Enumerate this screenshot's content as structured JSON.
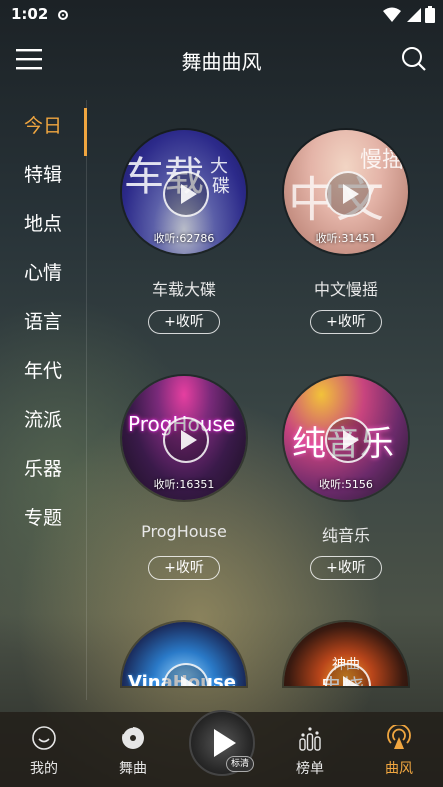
{
  "status": {
    "time": "1:02"
  },
  "header": {
    "title": "舞曲曲风"
  },
  "sidebar": {
    "items": [
      {
        "label": "今日"
      },
      {
        "label": "特辑"
      },
      {
        "label": "地点"
      },
      {
        "label": "心情"
      },
      {
        "label": "语言"
      },
      {
        "label": "年代"
      },
      {
        "label": "流派"
      },
      {
        "label": "乐器"
      },
      {
        "label": "专题"
      }
    ],
    "active_index": 0
  },
  "cards": [
    {
      "name": "车载大碟",
      "listens": "收听:62786",
      "add_label": "+收听",
      "cover_text": "车载",
      "cover_text2": "大",
      "cover_text3": "碟"
    },
    {
      "name": "中文慢摇",
      "listens": "收听:31451",
      "add_label": "+收听",
      "cover_text": "中文",
      "cover_text2": "慢摇"
    },
    {
      "name": "ProgHouse",
      "listens": "收听:16351",
      "add_label": "+收听",
      "cover_text": "ProgHouse"
    },
    {
      "name": "纯音乐",
      "listens": "收听:5156",
      "add_label": "+收听",
      "cover_text": "纯音乐"
    },
    {
      "cover_text": "VinaHouse"
    },
    {
      "cover_text": "神曲",
      "cover_text2": "串烧"
    }
  ],
  "nav": {
    "items": [
      {
        "label": "我的"
      },
      {
        "label": "舞曲"
      },
      {
        "label": "榜单"
      },
      {
        "label": "曲风"
      }
    ],
    "active_index": 3,
    "quality_badge": "标清"
  },
  "colors": {
    "accent": "#f0a640"
  }
}
